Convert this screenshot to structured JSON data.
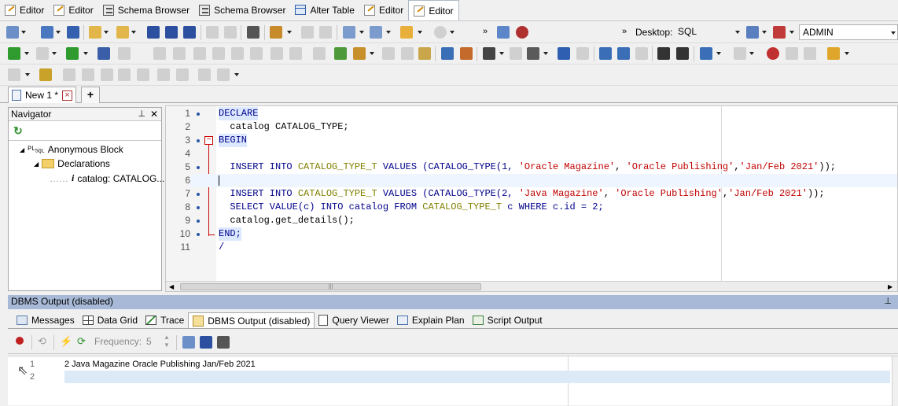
{
  "window_tabs": [
    {
      "label": "Editor",
      "icon": "editor-icon"
    },
    {
      "label": "Editor",
      "icon": "editor-icon"
    },
    {
      "label": "Schema Browser",
      "icon": "schema-browser-icon"
    },
    {
      "label": "Schema Browser",
      "icon": "schema-browser-icon"
    },
    {
      "label": "Alter Table",
      "icon": "alter-table-icon"
    },
    {
      "label": "Editor",
      "icon": "editor-icon"
    },
    {
      "label": "Editor",
      "icon": "editor-icon",
      "active": true
    }
  ],
  "toolbar": {
    "desktop_label": "Desktop:",
    "desktop_value": "SQL",
    "connection_value": "ADMIN"
  },
  "doc_tab": {
    "label": "New 1 *",
    "add_label": "+"
  },
  "navigator": {
    "title": "Navigator",
    "tree": [
      {
        "label": "Anonymous Block",
        "icon": "plsql-block-icon"
      },
      {
        "label": "Declarations",
        "icon": "folder-icon"
      },
      {
        "label": "catalog: CATALOG...",
        "icon": "variable-icon"
      }
    ]
  },
  "editor": {
    "line_numbers": [
      "1",
      "2",
      "3",
      "4",
      "5",
      "6",
      "7",
      "8",
      "9",
      "10",
      "11"
    ],
    "lines": {
      "l1": "DECLARE",
      "l2": "  catalog CATALOG_TYPE;",
      "l3": "BEGIN",
      "l5a": "  INSERT INTO ",
      "l5b": "CATALOG_TYPE_T",
      "l5c": " VALUES (CATALOG_TYPE(1, ",
      "l5d": "'Oracle Magazine'",
      "l5e": ", ",
      "l5f": "'Oracle Publishing'",
      "l5g": ",",
      "l5h": "'Jan/Feb 2021'",
      "l5i": "));",
      "l7a": "  INSERT INTO ",
      "l7b": "CATALOG_TYPE_T",
      "l7c": " VALUES (CATALOG_TYPE(2, ",
      "l7d": "'Java Magazine'",
      "l7e": ", ",
      "l7f": "'Oracle Publishing'",
      "l7g": ",",
      "l7h": "'Jan/Feb 2021'",
      "l7i": "));",
      "l8a": "  SELECT VALUE(c) INTO catalog FROM ",
      "l8b": "CATALOG_TYPE_T",
      "l8c": " c WHERE c.id = 2;",
      "l9": "  catalog.get_details();",
      "l10": "END;",
      "l11": "/"
    },
    "scroll_grip": "|||"
  },
  "dbms_panel": {
    "title": "DBMS Output (disabled)",
    "tabs": [
      {
        "label": "Messages",
        "icon": "messages-icon"
      },
      {
        "label": "Data Grid",
        "icon": "data-grid-icon"
      },
      {
        "label": "Trace",
        "icon": "trace-icon"
      },
      {
        "label": "DBMS Output (disabled)",
        "icon": "dbms-output-icon",
        "active": true
      },
      {
        "label": "Query Viewer",
        "icon": "query-viewer-icon"
      },
      {
        "label": "Explain Plan",
        "icon": "explain-plan-icon"
      },
      {
        "label": "Script Output",
        "icon": "script-output-icon"
      }
    ],
    "frequency_label": "Frequency:",
    "frequency_value": "5",
    "output_line_numbers": [
      "1",
      "2"
    ],
    "output_lines": [
      "2 Java Magazine Oracle Publishing Jan/Feb 2021",
      ""
    ]
  }
}
